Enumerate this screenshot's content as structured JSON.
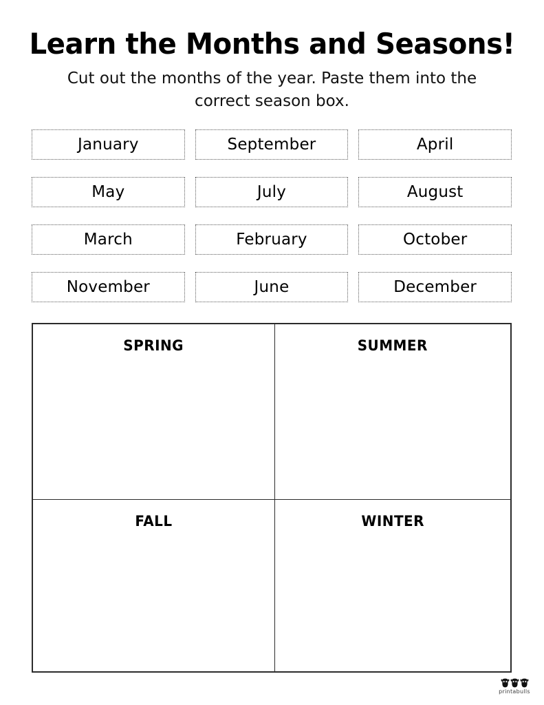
{
  "header": {
    "title": "Learn the Months and Seasons!",
    "subtitle": "Cut out the months of the year. Paste them into the correct season box."
  },
  "month_cards": [
    {
      "label": "January"
    },
    {
      "label": "September"
    },
    {
      "label": "April"
    },
    {
      "label": "May"
    },
    {
      "label": "July"
    },
    {
      "label": "August"
    },
    {
      "label": "March"
    },
    {
      "label": "February"
    },
    {
      "label": "October"
    },
    {
      "label": "November"
    },
    {
      "label": "June"
    },
    {
      "label": "December"
    }
  ],
  "seasons": [
    {
      "label": "SPRING"
    },
    {
      "label": "SUMMER"
    },
    {
      "label": "FALL"
    },
    {
      "label": "WINTER"
    }
  ],
  "brand": {
    "name": "printabulls"
  },
  "colors": {
    "ink": "#000000",
    "cut_line": "#5a5a5a",
    "grid_line": "#2b2b2b",
    "paper": "#ffffff",
    "brand_text": "#3d3d3d"
  }
}
